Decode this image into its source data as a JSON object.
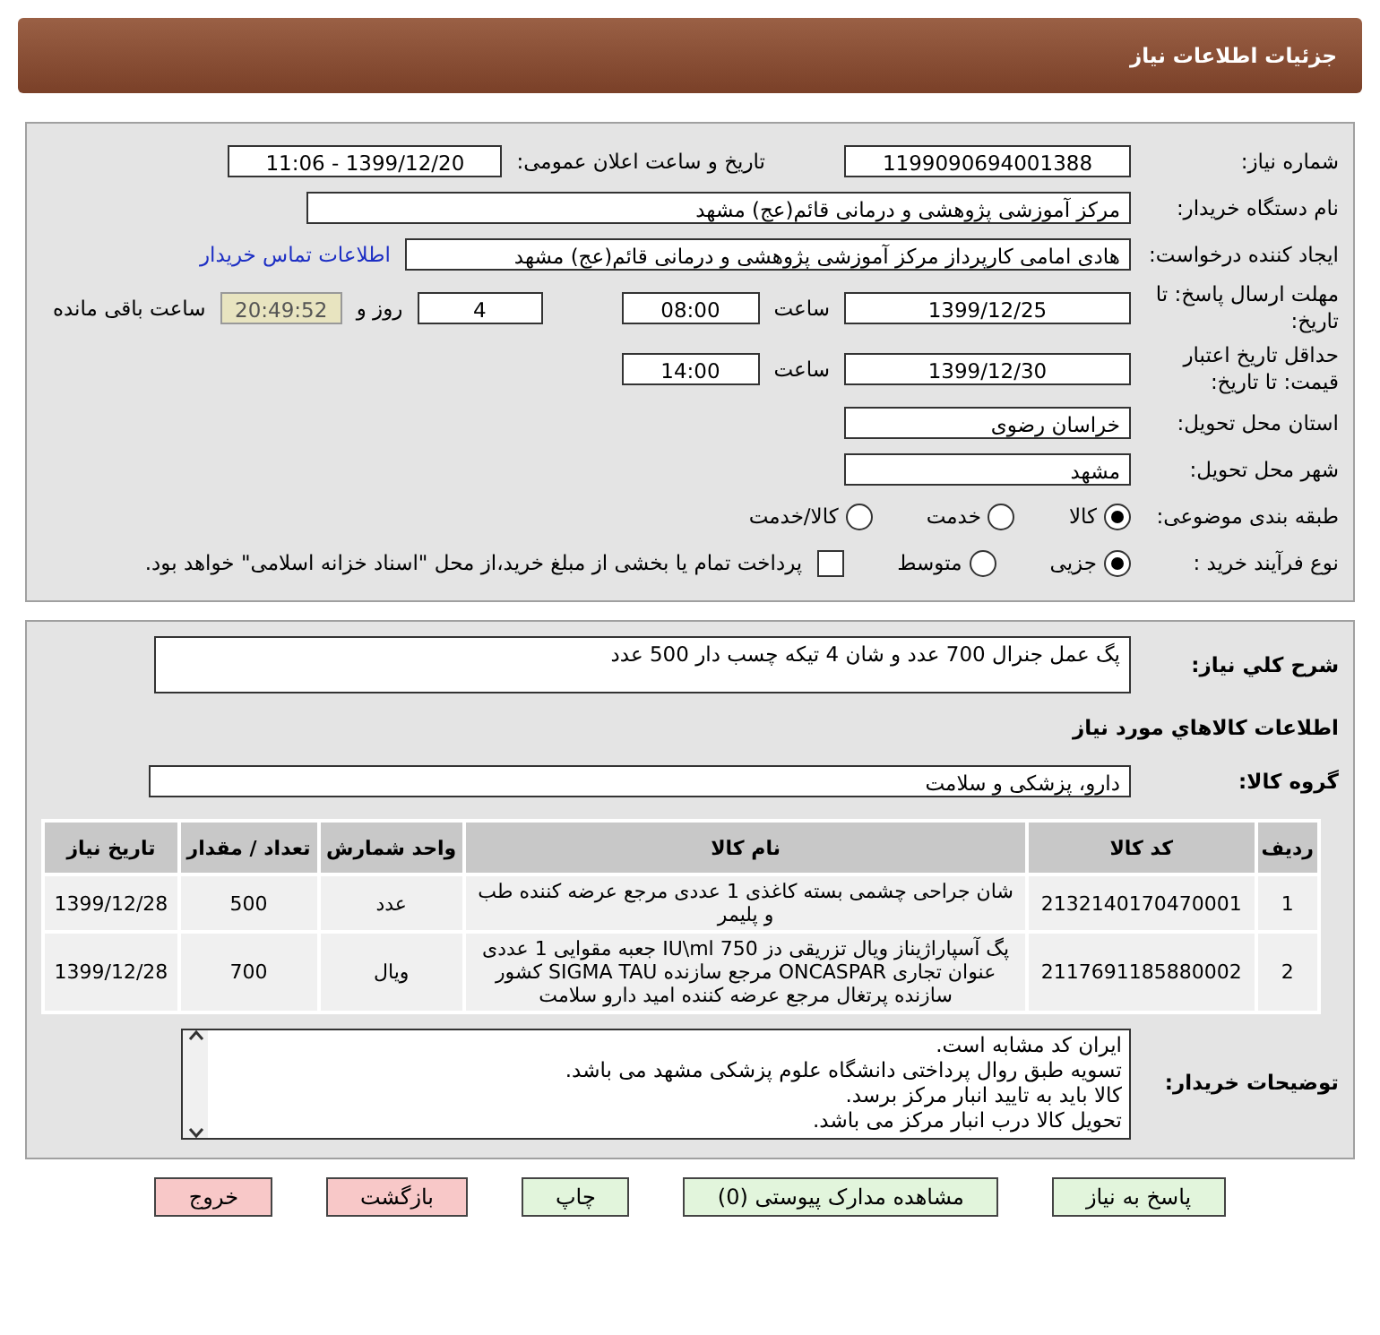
{
  "header": {
    "title": "جزئیات اطلاعات نیاز"
  },
  "need_number": {
    "label": "شماره نیاز:",
    "value": "1199090694001388"
  },
  "announce": {
    "label": "تاریخ و ساعت اعلان عمومی:",
    "value": "1399/12/20 - 11:06"
  },
  "buyer_org": {
    "label": "نام دستگاه خریدار:",
    "value": "مرکز آموزشی پژوهشی و درمانی قائم(عج) مشهد"
  },
  "requester": {
    "label": "ایجاد کننده درخواست:",
    "value": "هادی امامی کارپرداز مرکز آموزشی پژوهشی و درمانی قائم(عج) مشهد",
    "link": "اطلاعات تماس خریدار"
  },
  "deadline": {
    "label": "مهلت ارسال پاسخ: تا تاریخ:",
    "date": "1399/12/25",
    "time_label": "ساعت",
    "time": "08:00",
    "days": "4",
    "days_label": "روز و",
    "remaining": "20:49:52",
    "remaining_label": "ساعت باقی مانده"
  },
  "validity": {
    "label": "حداقل تاریخ اعتبار قیمت: تا تاریخ:",
    "date": "1399/12/30",
    "time_label": "ساعت",
    "time": "14:00"
  },
  "province": {
    "label": "استان محل تحویل:",
    "value": "خراسان رضوی"
  },
  "city": {
    "label": "شهر محل تحویل:",
    "value": "مشهد"
  },
  "category": {
    "label": "طبقه بندی موضوعی:",
    "options": [
      {
        "label": "کالا",
        "selected": true
      },
      {
        "label": "خدمت",
        "selected": false
      },
      {
        "label": "کالا/خدمت",
        "selected": false
      }
    ]
  },
  "process": {
    "label": "نوع فرآیند خرید :",
    "options": [
      {
        "label": "جزیی",
        "selected": true
      },
      {
        "label": "متوسط",
        "selected": false
      }
    ],
    "payment_note": {
      "label": "پرداخت تمام یا بخشی از مبلغ خرید،از محل \"اسناد خزانه اسلامی\" خواهد بود.",
      "checked": false
    }
  },
  "description": {
    "label": "شرح كلي نياز:",
    "value": "پگ عمل جنرال 700 عدد و شان 4 تیکه چسب دار 500 عدد"
  },
  "goods_title": "اطلاعات كالاهاي مورد نياز",
  "goods_group": {
    "label": "گروه کالا:",
    "value": "دارو، پزشکی و سلامت"
  },
  "table": {
    "columns": [
      "ردیف",
      "کد کالا",
      "نام کالا",
      "واحد شمارش",
      "تعداد / مقدار",
      "تاریخ نیاز"
    ],
    "rows": [
      [
        "1",
        "2132140170470001",
        "شان جراحی چشمی بسته کاغذی 1 عددی مرجع عرضه کننده طب و پلیمر",
        "عدد",
        "500",
        "1399/12/28"
      ],
      [
        "2",
        "2117691185880002",
        "پگ آسپاراژیناز ویال تزریقی دز 750 IU\\ml جعبه مقوایی 1 عددی عنوان تجاری ONCASPAR مرجع سازنده SIGMA TAU کشور سازنده پرتغال مرجع عرضه کننده امید دارو سلامت",
        "ویال",
        "700",
        "1399/12/28"
      ]
    ]
  },
  "buyer_notes": {
    "label": "توضیحات خریدار:",
    "lines": [
      "ایران کد مشابه است.",
      "تسویه طبق روال پرداختی دانشگاه علوم پزشکی مشهد می باشد.",
      "کالا باید به تایید انبار مرکز برسد.",
      "تحویل کالا درب انبار مرکز می باشد."
    ]
  },
  "buttons": [
    {
      "label": "پاسخ به نیاز",
      "kind": "primary"
    },
    {
      "label": "مشاهده مدارک پیوستی (0)",
      "kind": "primary"
    },
    {
      "label": "چاپ",
      "kind": "primary"
    },
    {
      "label": "بازگشت",
      "kind": "danger"
    },
    {
      "label": "خروج",
      "kind": "danger"
    }
  ]
}
